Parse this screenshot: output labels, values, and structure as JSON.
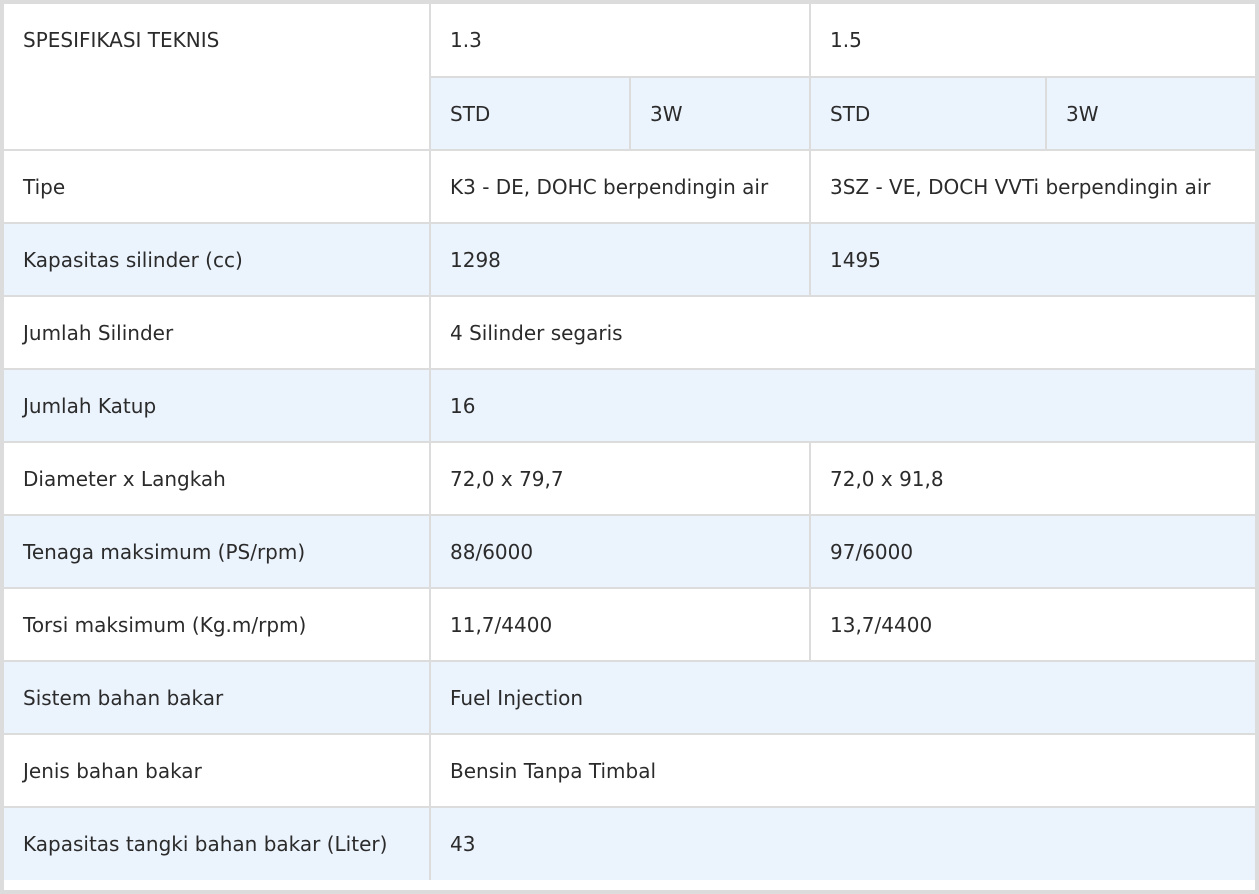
{
  "header": {
    "title": "SPESIFIKASI TEKNIS",
    "engine_13": "1.3",
    "engine_15": "1.5",
    "variants": [
      "STD",
      "3W",
      "STD",
      "3W"
    ]
  },
  "rows": [
    {
      "label": "Tipe",
      "v13": "K3 - DE, DOHC berpendingin air",
      "v15": "3SZ - VE, DOCH VVTi berpendingin air"
    },
    {
      "label": "Kapasitas silinder (cc)",
      "v13": "1298",
      "v15": "1495"
    },
    {
      "label": "Jumlah Silinder",
      "all": "4 Silinder segaris"
    },
    {
      "label": "Jumlah Katup",
      "all": "16"
    },
    {
      "label": "Diameter x Langkah",
      "v13": "72,0 x 79,7",
      "v15": "72,0 x 91,8"
    },
    {
      "label": "Tenaga maksimum (PS/rpm)",
      "v13": "88/6000",
      "v15": "97/6000"
    },
    {
      "label": "Torsi maksimum (Kg.m/rpm)",
      "v13": "11,7/4400",
      "v15": "13,7/4400"
    },
    {
      "label": "Sistem bahan bakar",
      "all": "Fuel Injection"
    },
    {
      "label": "Jenis bahan bakar",
      "all": "Bensin Tanpa Timbal"
    },
    {
      "label": "Kapasitas tangki bahan bakar (Liter)",
      "all": "43"
    }
  ]
}
